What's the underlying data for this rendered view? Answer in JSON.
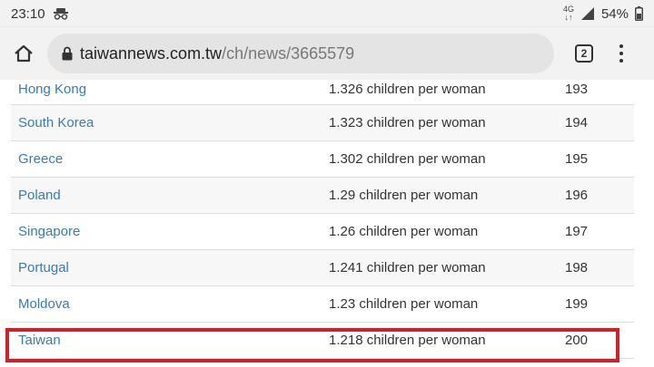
{
  "status_bar": {
    "time": "23:10",
    "network_top": "4G",
    "network_bottom": "↓↑",
    "battery": "54%"
  },
  "toolbar": {
    "url_host": "taiwannews.com.tw",
    "url_path": "/ch/news/3665579",
    "tab_count": "2"
  },
  "table": {
    "rows": [
      {
        "country": "Hong Kong",
        "rate": "1.326 children per woman",
        "rank": "193"
      },
      {
        "country": "South Korea",
        "rate": "1.323 children per woman",
        "rank": "194"
      },
      {
        "country": "Greece",
        "rate": "1.302 children per woman",
        "rank": "195"
      },
      {
        "country": "Poland",
        "rate": "1.29 children per woman",
        "rank": "196"
      },
      {
        "country": "Singapore",
        "rate": "1.26 children per woman",
        "rank": "197"
      },
      {
        "country": "Portugal",
        "rate": "1.241 children per woman",
        "rank": "198"
      },
      {
        "country": "Moldova",
        "rate": "1.23 children per woman",
        "rank": "199"
      },
      {
        "country": "Taiwan",
        "rate": "1.218 children per woman",
        "rank": "200"
      }
    ]
  },
  "colors": {
    "link": "#3a7bb0",
    "highlight": "#d0202a"
  }
}
